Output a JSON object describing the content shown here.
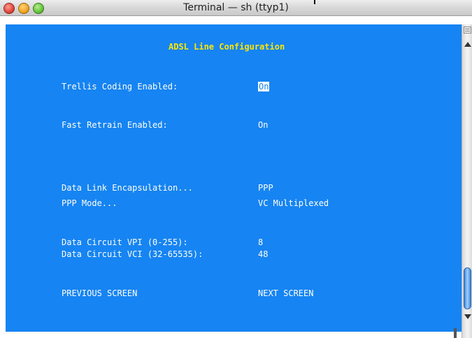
{
  "window": {
    "title": "Terminal — sh (ttyp1)"
  },
  "terminal": {
    "heading": "ADSL Line Configuration",
    "rows": [
      {
        "label": "Trellis Coding Enabled:",
        "value": "On"
      },
      {
        "label": "Fast Retrain Enabled:",
        "value": "On"
      },
      {
        "label": "Data Link Encapsulation...",
        "value": "PPP"
      },
      {
        "label": "PPP Mode...",
        "value": "VC Multiplexed"
      },
      {
        "label": "Data Circuit VPI (0-255):",
        "value": "8"
      },
      {
        "label": "Data Circuit VCI (32-65535):",
        "value": "48"
      }
    ],
    "nav": {
      "previous": "PREVIOUS SCREEN",
      "next": "NEXT SCREEN"
    }
  },
  "colors": {
    "terminal_background": "#1684f3",
    "heading_text": "#ffe600",
    "text": "#ffffff"
  }
}
